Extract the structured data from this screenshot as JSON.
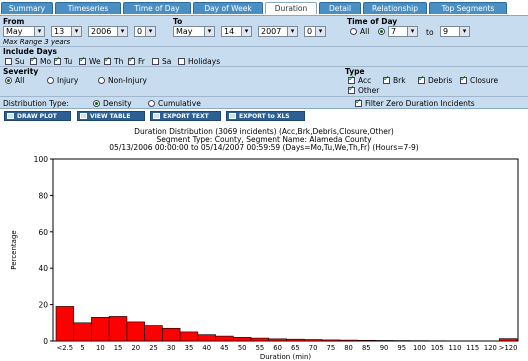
{
  "tabs": [
    {
      "label": "Summary",
      "active": false
    },
    {
      "label": "Timeseries",
      "active": false
    },
    {
      "label": "Time of Day",
      "active": false
    },
    {
      "label": "Day of Week",
      "active": false
    },
    {
      "label": "Duration",
      "active": true
    },
    {
      "label": "Detail",
      "active": false
    },
    {
      "label": "Relationship",
      "active": false
    },
    {
      "label": "Top Segments",
      "active": false
    }
  ],
  "filters": {
    "from_label": "From",
    "to_label": "To",
    "time_of_day_label": "Time of Day",
    "from": {
      "month": "May",
      "day": "13",
      "year": "2006",
      "hour": "0"
    },
    "to": {
      "month": "May",
      "day": "14",
      "year": "2007",
      "hour": "0"
    },
    "tod": {
      "all_label": "All",
      "from_hour": "7",
      "to_label": "to",
      "to_hour": "9"
    },
    "max_range": "Max Range 3 years",
    "include_days_label": "Include Days",
    "days": [
      {
        "label": "Su",
        "checked": false
      },
      {
        "label": "Mo",
        "checked": true
      },
      {
        "label": "Tu",
        "checked": true
      },
      {
        "label": "We",
        "checked": true
      },
      {
        "label": "Th",
        "checked": true
      },
      {
        "label": "Fr",
        "checked": true
      },
      {
        "label": "Sa",
        "checked": false
      },
      {
        "label": "Holidays",
        "checked": false
      }
    ],
    "severity_label": "Severity",
    "severity": [
      {
        "label": "All",
        "selected": true
      },
      {
        "label": "Injury",
        "selected": false
      },
      {
        "label": "Non-Injury",
        "selected": false
      }
    ],
    "type_label": "Type",
    "types": [
      {
        "label": "Acc",
        "checked": true
      },
      {
        "label": "Brk",
        "checked": true
      },
      {
        "label": "Debris",
        "checked": true
      },
      {
        "label": "Closure",
        "checked": true
      },
      {
        "label": "Other",
        "checked": true
      }
    ],
    "distribution_label": "Distribution Type:",
    "distribution": [
      {
        "label": "Density",
        "selected": true
      },
      {
        "label": "Cumulative",
        "selected": false
      }
    ],
    "filter_zero": {
      "label": "Filter Zero Duration Incidents",
      "checked": true
    }
  },
  "toolbar": {
    "draw": "DRAW PLOT",
    "view": "VIEW TABLE",
    "export_text": "EXPORT TEXT",
    "export_xls": "EXPORT to XLS"
  },
  "chart_data": {
    "type": "bar",
    "title": "Duration Distribution (3069 incidents) (Acc,Brk,Debris,Closure,Other)",
    "subtitle1": "Segment Type: County, Segment Name: Alameda County",
    "subtitle2": "05/13/2006 00:00:00 to 05/14/2007 00:59:59 (Days=Mo,Tu,We,Th,Fr) (Hours=7-9)",
    "xlabel": "Duration (min)",
    "ylabel": "Percentage",
    "ylim": [
      0,
      100
    ],
    "yticks": [
      0,
      20,
      40,
      60,
      80,
      100
    ],
    "bar_color": "#ff0000",
    "categories": [
      "<2.5",
      "5",
      "10",
      "15",
      "20",
      "25",
      "30",
      "35",
      "40",
      "45",
      "50",
      "55",
      "60",
      "65",
      "70",
      "75",
      "80",
      "85",
      "90",
      "95",
      "100",
      "105",
      "110",
      "115",
      "120",
      ">120"
    ],
    "xtick_labels": [
      "<2.5",
      "5",
      "10",
      "15",
      "20",
      "25",
      "30",
      "35",
      "40",
      "45",
      "50",
      "55",
      "60",
      "65",
      "70",
      "75",
      "80",
      "85",
      "90",
      "95",
      "100",
      "105",
      "110",
      "115",
      "120",
      ">120"
    ],
    "values": [
      19,
      10,
      13,
      13.5,
      10.5,
      8.5,
      7,
      5,
      3.5,
      2.7,
      2,
      1.6,
      1.2,
      1,
      0.8,
      0.6,
      0.5,
      0.4,
      0.3,
      0.25,
      0.2,
      0.15,
      0.1,
      0.1,
      0.1,
      1.3
    ]
  }
}
